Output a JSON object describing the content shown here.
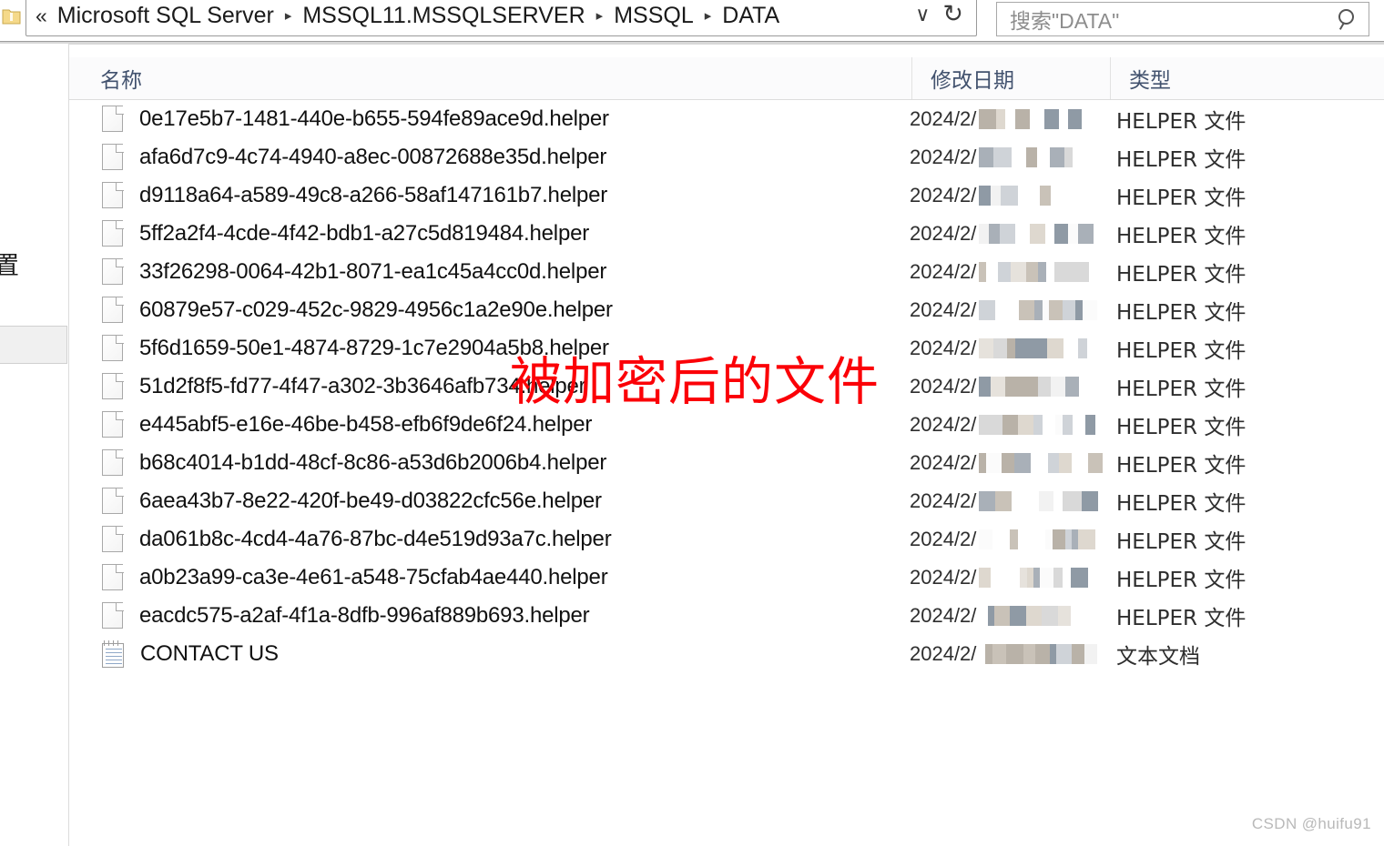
{
  "window": {
    "breadcrumb": {
      "collapse_icon": "«",
      "items": [
        "Microsoft SQL Server",
        "MSSQL11.MSSQLSERVER",
        "MSSQL",
        "DATA"
      ],
      "separator": "▸",
      "dropdown_icon": "∨",
      "refresh_icon": "↻"
    },
    "search": {
      "placeholder": "搜索\"DATA\"",
      "icon": "search-icon"
    },
    "left_pane_glyph": "置"
  },
  "columns": {
    "name": "名称",
    "date_modified": "修改日期",
    "type": "类型"
  },
  "types": {
    "helper": "HELPER 文件",
    "text": "文本文档"
  },
  "date_prefix": "2024/2/",
  "files": [
    {
      "name": "0e17e5b7-1481-440e-b655-594fe89ace9d.helper",
      "icon": "file-icon",
      "date": "2024/2/",
      "type": "HELPER 文件"
    },
    {
      "name": "afa6d7c9-4c74-4940-a8ec-00872688e35d.helper",
      "icon": "file-icon",
      "date": "2024/2/",
      "type": "HELPER 文件"
    },
    {
      "name": "d9118a64-a589-49c8-a266-58af147161b7.helper",
      "icon": "file-icon",
      "date": "2024/2/",
      "type": "HELPER 文件"
    },
    {
      "name": "5ff2a2f4-4cde-4f42-bdb1-a27c5d819484.helper",
      "icon": "file-icon",
      "date": "2024/2/",
      "type": "HELPER 文件"
    },
    {
      "name": "33f26298-0064-42b1-8071-ea1c45a4cc0d.helper",
      "icon": "file-icon",
      "date": "2024/2/",
      "type": "HELPER 文件"
    },
    {
      "name": "60879e57-c029-452c-9829-4956c1a2e90e.helper",
      "icon": "file-icon",
      "date": "2024/2/",
      "type": "HELPER 文件"
    },
    {
      "name": "5f6d1659-50e1-4874-8729-1c7e2904a5b8.helper",
      "icon": "file-icon",
      "date": "2024/2/",
      "type": "HELPER 文件"
    },
    {
      "name": "51d2f8f5-fd77-4f47-a302-3b3646afb734.helper",
      "icon": "file-icon",
      "date": "2024/2/",
      "type": "HELPER 文件"
    },
    {
      "name": "e445abf5-e16e-46be-b458-efb6f9de6f24.helper",
      "icon": "file-icon",
      "date": "2024/2/",
      "type": "HELPER 文件"
    },
    {
      "name": "b68c4014-b1dd-48cf-8c86-a53d6b2006b4.helper",
      "icon": "file-icon",
      "date": "2024/2/",
      "type": "HELPER 文件"
    },
    {
      "name": "6aea43b7-8e22-420f-be49-d03822cfc56e.helper",
      "icon": "file-icon",
      "date": "2024/2/",
      "type": "HELPER 文件"
    },
    {
      "name": "da061b8c-4cd4-4a76-87bc-d4e519d93a7c.helper",
      "icon": "file-icon",
      "date": "2024/2/",
      "type": "HELPER 文件"
    },
    {
      "name": "a0b23a99-ca3e-4e61-a548-75cfab4ae440.helper",
      "icon": "file-icon",
      "date": "2024/2/",
      "type": "HELPER 文件"
    },
    {
      "name": "eacdc575-a2af-4f1a-8dfb-996af889b693.helper",
      "icon": "file-icon",
      "date": "2024/2/",
      "type": "HELPER 文件"
    },
    {
      "name": "CONTACT US",
      "icon": "notepad-icon",
      "date": "2024/2/",
      "type": "文本文档"
    }
  ],
  "annotation": {
    "text": "被加密后的文件",
    "color": "#fb0007"
  },
  "watermark": "CSDN @huifu91"
}
